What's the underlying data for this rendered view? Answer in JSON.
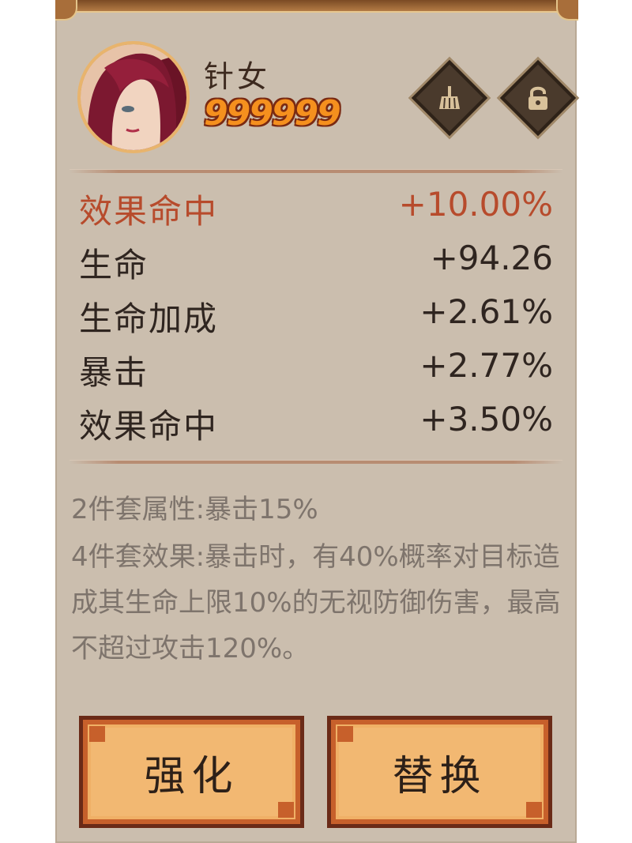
{
  "character": {
    "name": "针女",
    "power": "999999",
    "portrait_icon": "character-portrait-icon"
  },
  "toolbar": {
    "clean_icon": "broom-icon",
    "lock_icon": "lock-icon"
  },
  "stats": {
    "main": {
      "label": "效果命中",
      "value": "+10.00%"
    },
    "sub": [
      {
        "label": "生命",
        "value": "+94.26"
      },
      {
        "label": "生命加成",
        "value": "+2.61%"
      },
      {
        "label": "暴击",
        "value": "+2.77%"
      },
      {
        "label": "效果命中",
        "value": "+3.50%"
      }
    ]
  },
  "set_bonus": {
    "two_piece": "2件套属性:暴击15%",
    "four_piece": "4件套效果:暴击时，有40%概率对目标造成其生命上限10%的无视防御伤害，最高不超过攻击120%。"
  },
  "actions": {
    "enhance_label": "强化",
    "replace_label": "替换"
  },
  "colors": {
    "panel_bg": "#cbbeae",
    "main_stat": "#b74b2c",
    "power_orange": "#f5901e",
    "button_fill": "#f2b872"
  }
}
